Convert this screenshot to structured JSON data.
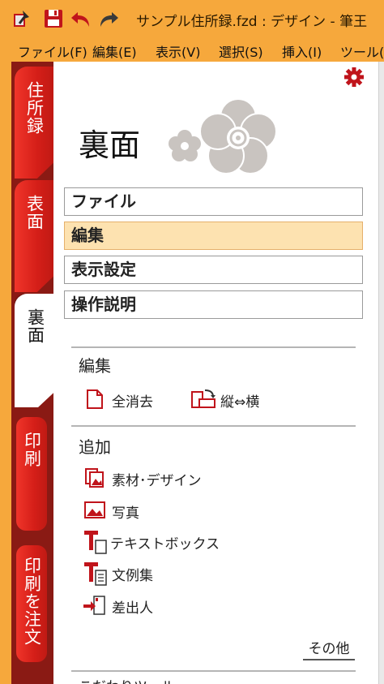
{
  "window": {
    "title": "サンプル住所録.fzd : デザイン - 筆王"
  },
  "menu": [
    "ファイル(F)",
    "編集(E)",
    "表示(V)",
    "選択(S)",
    "挿入(I)",
    "ツール(T)"
  ],
  "side_tabs": [
    {
      "label": "住所録",
      "state": "inactive"
    },
    {
      "label": "表面",
      "state": "inactive"
    },
    {
      "label": "裏面",
      "state": "active"
    },
    {
      "label": "印刷",
      "state": "inactive"
    },
    {
      "label": "印刷を注文",
      "state": "inactive"
    }
  ],
  "panel": {
    "heading": "裏面",
    "nav": [
      {
        "label": "ファイル",
        "selected": false
      },
      {
        "label": "編集",
        "selected": true
      },
      {
        "label": "表示設定",
        "selected": false
      },
      {
        "label": "操作説明",
        "selected": false
      }
    ],
    "sections": {
      "edit": {
        "title": "編集",
        "actions": [
          {
            "label": "全消去",
            "icon": "blank-page-icon"
          },
          {
            "label": "縦⇔横",
            "icon": "rotate-page-icon"
          }
        ]
      },
      "add": {
        "title": "追加",
        "actions": [
          {
            "label": "素材･デザイン",
            "icon": "material-design-icon"
          },
          {
            "label": "写真",
            "icon": "photo-icon"
          },
          {
            "label": "テキストボックス",
            "icon": "textbox-icon"
          },
          {
            "label": "文例集",
            "icon": "sample-text-icon"
          },
          {
            "label": "差出人",
            "icon": "sender-icon"
          }
        ]
      }
    },
    "more_label": "その他",
    "next_section_partial": "こだわりツール"
  },
  "colors": {
    "titlebar": "#f6a83c",
    "tab_red": "#d41e18",
    "rail_dark": "#8a1a14",
    "selected_nav": "#fde2b0",
    "icon_red": "#c0141b",
    "flower": "#c9c4c0"
  }
}
